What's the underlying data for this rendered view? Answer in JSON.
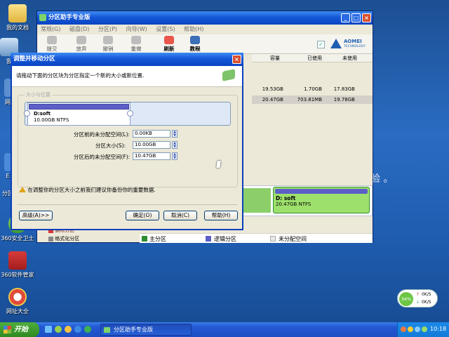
{
  "desktop": {
    "icons": [
      {
        "label": "我的文档",
        "icon": "folder-documents-icon"
      },
      {
        "label": "我",
        "icon": "computer-icon"
      },
      {
        "label": "网",
        "icon": "network-icon"
      },
      {
        "label": "E",
        "icon": "ie-icon"
      },
      {
        "label": "分区",
        "icon": "partition-icon"
      },
      {
        "label": "360安全卫士",
        "icon": "shield-icon"
      },
      {
        "label": "360软件管家",
        "icon": "software-manager-icon"
      },
      {
        "label": "网址大全",
        "icon": "browser-icon"
      }
    ],
    "watermark": "验 。"
  },
  "main_window": {
    "title": "分区助手专业版",
    "menu": [
      "常规(G)",
      "磁盘(D)",
      "分区(P)",
      "向导(W)",
      "设置(S)",
      "帮助(H)"
    ],
    "toolbar": [
      {
        "label": "提交",
        "icon": "commit-icon",
        "enabled": false
      },
      {
        "label": "放弃",
        "icon": "discard-icon",
        "enabled": false
      },
      {
        "label": "撤销",
        "icon": "undo-icon",
        "enabled": false
      },
      {
        "label": "重做",
        "icon": "redo-icon",
        "enabled": false
      },
      {
        "label": "刷新",
        "icon": "refresh-icon",
        "enabled": true
      },
      {
        "label": "教程",
        "icon": "tutorial-icon",
        "enabled": true
      }
    ],
    "brand": {
      "name": "AOMEI",
      "sub": "TECHNOLOGY"
    },
    "columns": [
      "容量",
      "已使用",
      "未使用"
    ],
    "rows": [
      {
        "capacity": "19.53GB",
        "used": "1.70GB",
        "free": "17.83GB",
        "selected": false
      },
      {
        "capacity": "20.47GB",
        "used": "703.81MB",
        "free": "19.78GB",
        "selected": true
      }
    ],
    "disk_map": {
      "partition": {
        "name": "D: soft",
        "size": "20.47GB NTFS"
      }
    },
    "side_items": [
      "删除分区",
      "格式化分区"
    ],
    "legend": [
      {
        "label": "主分区",
        "color": "#2f8d2f"
      },
      {
        "label": "逻辑分区",
        "color": "#5b5fc7"
      },
      {
        "label": "未分配空间",
        "color": "#e8e8e8"
      }
    ]
  },
  "dialog": {
    "title": "调整并移动分区",
    "instruction": "请拖动下面的分区块为分区指定一个新的大小或新位置.",
    "group_label": "大小与位置",
    "partition": {
      "name": "D:soft",
      "size": "10.00GB NTFS",
      "fill_fraction": 0.5
    },
    "fields": [
      {
        "label": "分区前的未分配空间(L):",
        "value": "0.00KB"
      },
      {
        "label": "分区大小(S):",
        "value": "10.00GB"
      },
      {
        "label": "分区后的未分配空间(F):",
        "value": "10.47GB"
      }
    ],
    "warning": "在调整你的分区大小之前我们建议你备份你的重要数据.",
    "buttons": {
      "advanced": "高级(A)>>",
      "ok": "确定(O)",
      "cancel": "取消(C)",
      "help": "帮助(H)"
    }
  },
  "taskbar": {
    "start": "开始",
    "task": "分区助手专业版",
    "clock": "10:18"
  },
  "monitor": {
    "percent": "34%",
    "up": "0K/S",
    "down": "0K/S"
  }
}
